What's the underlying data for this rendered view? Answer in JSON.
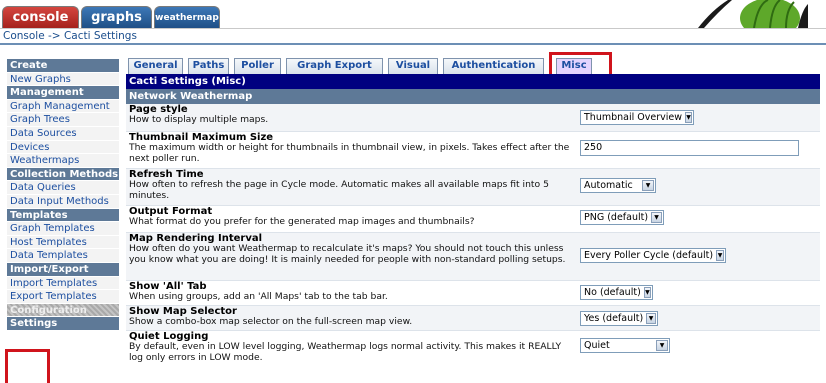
{
  "top_tabs": [
    {
      "label": "console",
      "color": "#c0322b"
    },
    {
      "label": "graphs",
      "color": "#2e62a1"
    },
    {
      "label": "weathermap",
      "color": "#2e62a1"
    }
  ],
  "breadcrumb": "Console -> Cacti Settings",
  "sidebar": {
    "items": [
      {
        "label": "Create",
        "type": "header"
      },
      {
        "label": "New Graphs",
        "type": "link"
      },
      {
        "label": "Management",
        "type": "header"
      },
      {
        "label": "Graph Management",
        "type": "link"
      },
      {
        "label": "Graph Trees",
        "type": "link"
      },
      {
        "label": "Data Sources",
        "type": "link"
      },
      {
        "label": "Devices",
        "type": "link"
      },
      {
        "label": "Weathermaps",
        "type": "link"
      },
      {
        "label": "Collection Methods",
        "type": "header"
      },
      {
        "label": "Data Queries",
        "type": "link"
      },
      {
        "label": "Data Input Methods",
        "type": "link"
      },
      {
        "label": "Templates",
        "type": "header"
      },
      {
        "label": "Graph Templates",
        "type": "link"
      },
      {
        "label": "Host Templates",
        "type": "link"
      },
      {
        "label": "Data Templates",
        "type": "link"
      },
      {
        "label": "Import/Export",
        "type": "header"
      },
      {
        "label": "Import Templates",
        "type": "link"
      },
      {
        "label": "Export Templates",
        "type": "link"
      },
      {
        "label": "Configuration",
        "type": "header-dim"
      },
      {
        "label": "Settings",
        "type": "active"
      }
    ]
  },
  "settings_tabs": [
    {
      "label": "General",
      "active": false
    },
    {
      "label": "Paths",
      "active": false
    },
    {
      "label": "Poller",
      "active": false
    },
    {
      "label": "Graph Export",
      "active": false
    },
    {
      "label": "Visual",
      "active": false
    },
    {
      "label": "Authentication",
      "active": false
    },
    {
      "label": "Misc",
      "active": true
    }
  ],
  "main": {
    "title": "Cacti Settings (Misc)",
    "section": "Network Weathermap",
    "rows": [
      {
        "name": "Page style",
        "desc": "How to display multiple maps.",
        "control": "select",
        "value": "Thumbnail Overview"
      },
      {
        "name": "Thumbnail Maximum Size",
        "desc": "The maximum width or height for thumbnails in thumbnail view, in pixels. Takes effect after the next poller run.",
        "control": "text",
        "value": "250"
      },
      {
        "name": "Refresh Time",
        "desc": "How often to refresh the page in Cycle mode. Automatic makes all available maps fit into 5 minutes.",
        "control": "select",
        "value": "Automatic"
      },
      {
        "name": "Output Format",
        "desc": "What format do you prefer for the generated map images and thumbnails?",
        "control": "select",
        "value": "PNG (default)"
      },
      {
        "name": "Map Rendering Interval",
        "desc": "How often do you want Weathermap to recalculate it's maps? You should not touch this unless you know what you are doing! It is mainly needed for people with non-standard polling setups.",
        "control": "select",
        "value": "Every Poller Cycle (default)"
      },
      {
        "name": "Show 'All' Tab",
        "desc": "When using groups, add an 'All Maps' tab to the tab bar.",
        "control": "select",
        "value": "No (default)"
      },
      {
        "name": "Show Map Selector",
        "desc": "Show a combo-box map selector on the full-screen map view.",
        "control": "select",
        "value": "Yes (default)"
      },
      {
        "name": "Quiet Logging",
        "desc": "By default, even in LOW level logging, Weathermap logs normal activity. This makes it REALLY log only errors in LOW mode.",
        "control": "select",
        "value": "Quiet"
      }
    ]
  },
  "colors": {
    "header_bar": "#000080",
    "section_bar": "#5e7997",
    "link": "#1d4fa0",
    "highlight_box": "#d0141c"
  }
}
